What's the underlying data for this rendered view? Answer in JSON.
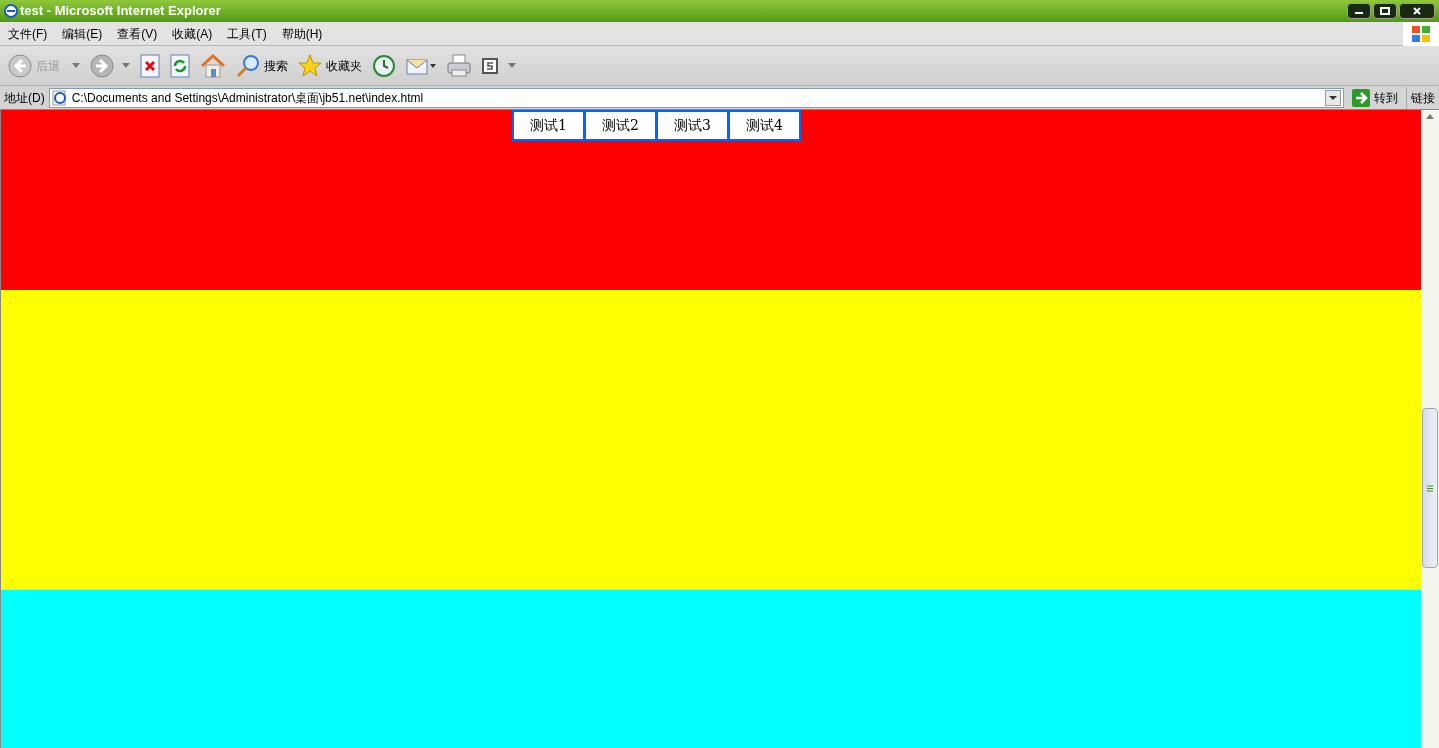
{
  "window": {
    "title": "test - Microsoft Internet Explorer"
  },
  "menu": [
    "文件(F)",
    "编辑(E)",
    "查看(V)",
    "收藏(A)",
    "工具(T)",
    "帮助(H)"
  ],
  "toolbar": [
    {
      "kind": "back",
      "label": "后退",
      "disabled": true
    },
    {
      "kind": "forward",
      "disabled": false
    },
    {
      "kind": "stop"
    },
    {
      "kind": "refresh"
    },
    {
      "kind": "home"
    },
    {
      "kind": "search",
      "label": "搜索"
    },
    {
      "kind": "favorites",
      "label": "收藏夹"
    },
    {
      "kind": "history"
    },
    {
      "kind": "mail"
    },
    {
      "kind": "print"
    },
    {
      "kind": "s"
    },
    {
      "kind": "more"
    }
  ],
  "address": {
    "label": "地址(D)",
    "value": "C:\\Documents and Settings\\Administrator\\桌面\\jb51.net\\index.html",
    "go": "转到",
    "links": "链接"
  },
  "page": {
    "buttons": [
      "测试1",
      "测试2",
      "测试3",
      "测试4"
    ],
    "bands": [
      {
        "color": "#ff0000"
      },
      {
        "color": "#ffff00"
      },
      {
        "color": "#00ffff"
      }
    ]
  }
}
